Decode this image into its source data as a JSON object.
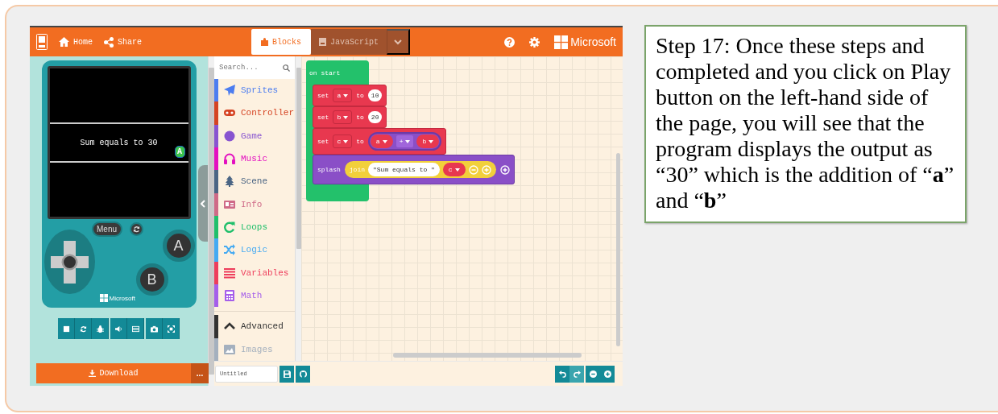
{
  "header": {
    "nav": [
      {
        "kind": "home",
        "label": "Home"
      },
      {
        "kind": "share",
        "label": "Share"
      }
    ],
    "tabs": [
      {
        "kind": "blocks",
        "label": "Blocks",
        "selected": true
      },
      {
        "kind": "javascript",
        "label": "JavaScript",
        "selected": false
      }
    ],
    "brand": "Microsoft"
  },
  "simulator": {
    "screen_text": "Sum equals to 30",
    "sprite_letter": "A",
    "menu_button": "Menu",
    "button_a": "A",
    "button_b": "B",
    "brand": "Microsoft",
    "download_button": "Download",
    "more_button": "..."
  },
  "toolbox": {
    "search_placeholder": "Search...",
    "categories": [
      {
        "kind": "sprites",
        "label": "Sprites",
        "color": "#4c7df0"
      },
      {
        "kind": "controller",
        "label": "Controller",
        "color": "#d54322"
      },
      {
        "kind": "game",
        "label": "Game",
        "color": "#8854d0"
      },
      {
        "kind": "music",
        "label": "Music",
        "color": "#e30fc0"
      },
      {
        "kind": "scene",
        "label": "Scene",
        "color": "#4b6584"
      },
      {
        "kind": "info",
        "label": "Info",
        "color": "#cf6a87"
      },
      {
        "kind": "loops",
        "label": "Loops",
        "color": "#20bf6b"
      },
      {
        "kind": "logic",
        "label": "Logic",
        "color": "#45aaf2"
      },
      {
        "kind": "variables",
        "label": "Variables",
        "color": "#ee3d5b"
      },
      {
        "kind": "math",
        "label": "Math",
        "color": "#a55eea"
      }
    ],
    "advanced": [
      {
        "kind": "advanced",
        "label": "Advanced",
        "color": "#333333"
      },
      {
        "kind": "images",
        "label": "Images",
        "color": "#a4b0be"
      }
    ]
  },
  "workspace": {
    "event": "on start",
    "blocks": [
      {
        "kind": "set",
        "keyword": "set",
        "variable": "a",
        "to": "to",
        "value": "10"
      },
      {
        "kind": "set",
        "keyword": "set",
        "variable": "b",
        "to": "to",
        "value": "20"
      },
      {
        "kind": "set_sum",
        "keyword": "set",
        "variable": "c",
        "to": "to",
        "left": "a",
        "operator": "+",
        "right": "b"
      },
      {
        "kind": "splash",
        "keyword": "splash",
        "join": "join",
        "text": "\"Sum equals to \"",
        "variable": "c"
      }
    ]
  },
  "project_name": "Untitled",
  "caption": "Step 17: Once these steps and completed and you click on Play button on the left-hand side of the page, you will see that the program displays the output as “30” which is the addition of “**a**” and “**b**”"
}
